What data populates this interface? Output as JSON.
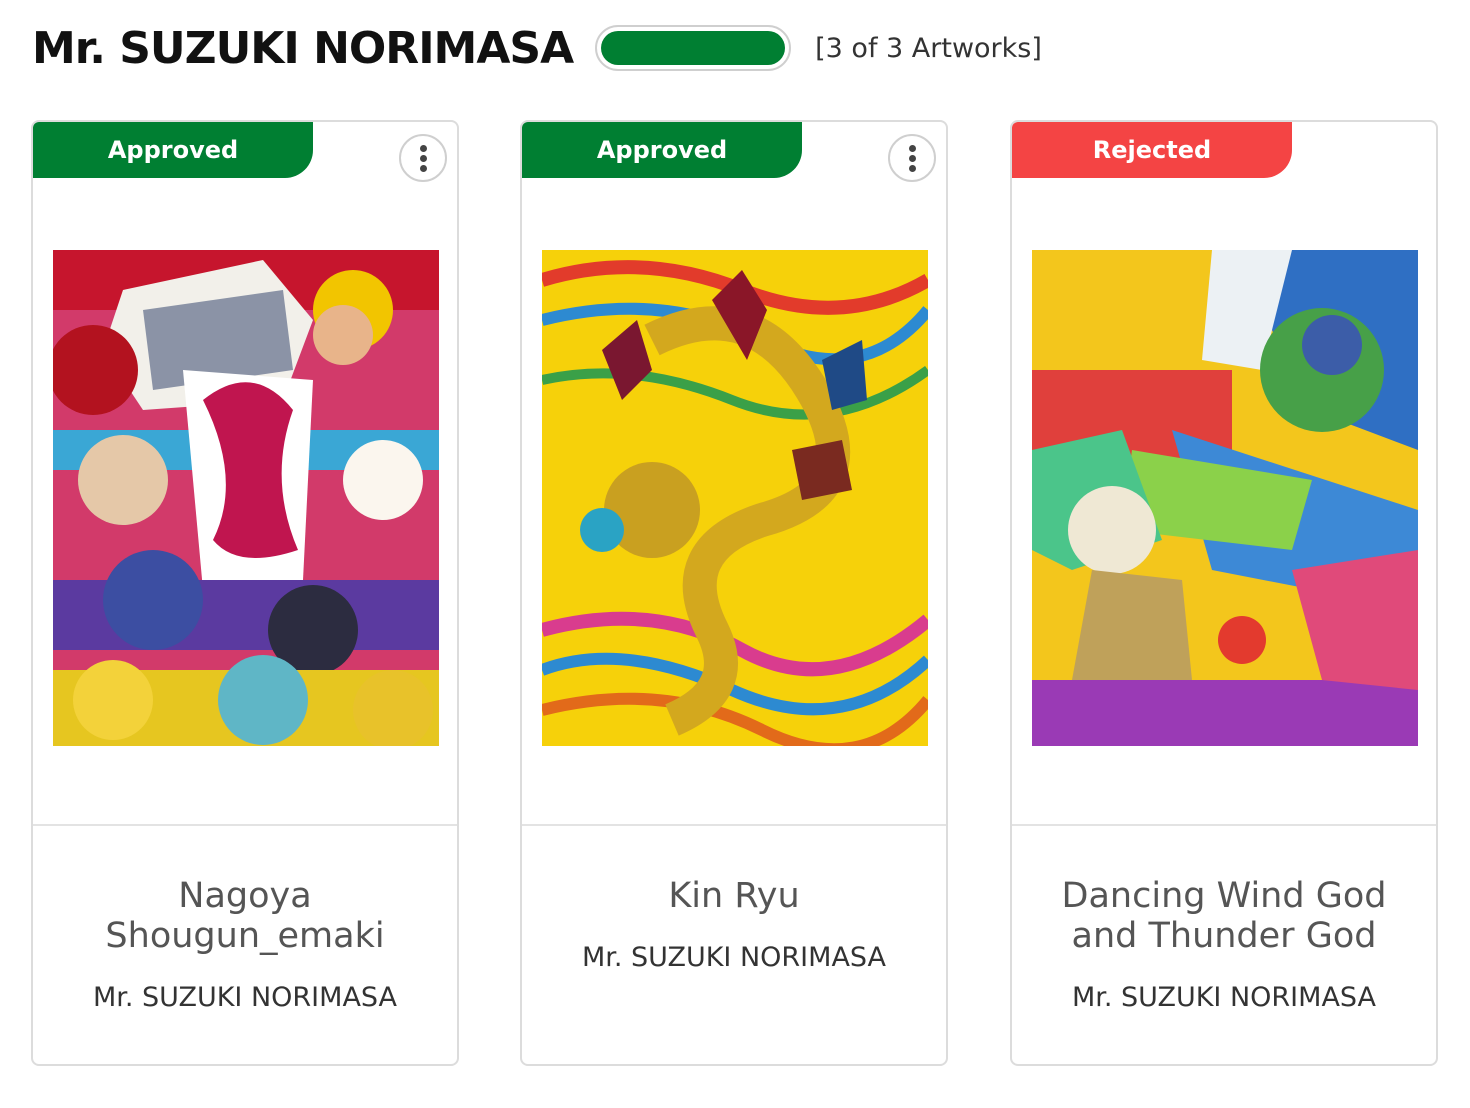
{
  "header": {
    "artist_name": "Mr. SUZUKI NORIMASA",
    "progress": 1.0,
    "progress_color": "#007f32",
    "count_text": "[3 of 3 Artworks]"
  },
  "colors": {
    "approved": "#007f32",
    "rejected": "#f44444"
  },
  "artworks": [
    {
      "status": "Approved",
      "status_color": "#007f32",
      "title": "Nagoya Shougun_emaki",
      "artist": "Mr. SUZUKI NORIMASA",
      "has_menu": true
    },
    {
      "status": "Approved",
      "status_color": "#007f32",
      "title": "Kin Ryu",
      "artist": "Mr. SUZUKI NORIMASA",
      "has_menu": true
    },
    {
      "status": "Rejected",
      "status_color": "#f44444",
      "title": "Dancing Wind God and Thunder God",
      "artist": "Mr. SUZUKI NORIMASA",
      "has_menu": false
    }
  ]
}
